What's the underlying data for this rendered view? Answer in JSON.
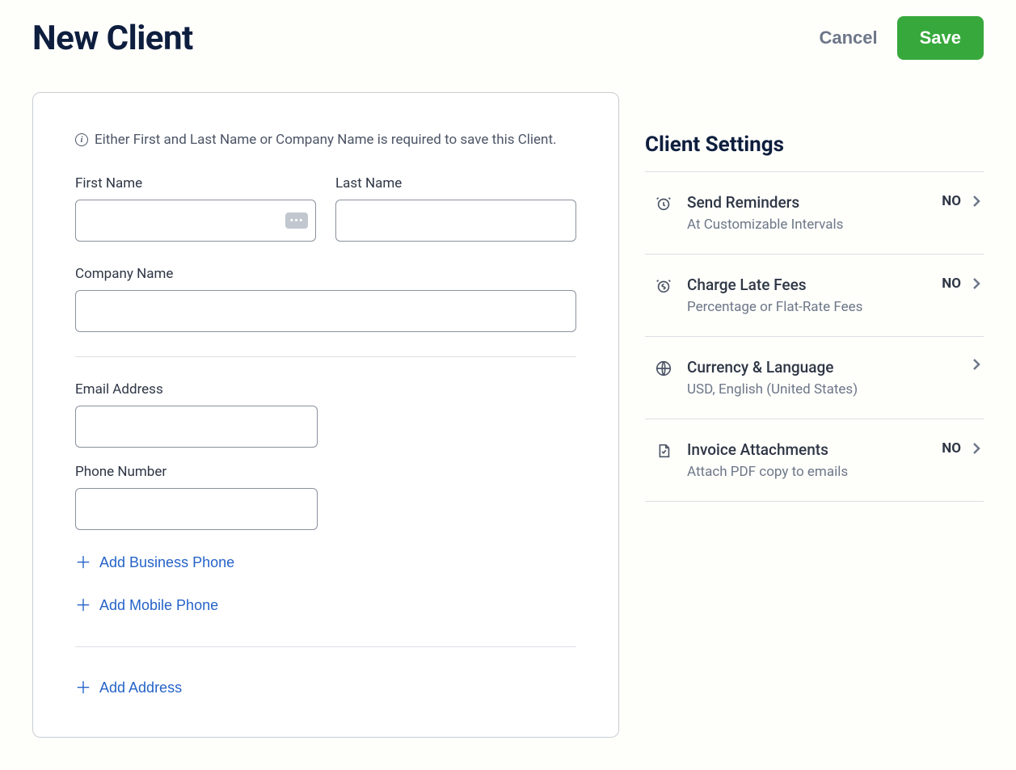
{
  "header": {
    "title": "New Client",
    "cancel_label": "Cancel",
    "save_label": "Save"
  },
  "form": {
    "info_text": "Either First and Last Name or Company Name is required to save this Client.",
    "first_name_label": "First Name",
    "first_name_value": "",
    "last_name_label": "Last Name",
    "last_name_value": "",
    "company_label": "Company Name",
    "company_value": "",
    "email_label": "Email Address",
    "email_value": "",
    "phone_label": "Phone Number",
    "phone_value": "",
    "add_business_phone": "Add Business Phone",
    "add_mobile_phone": "Add Mobile Phone",
    "add_address": "Add Address"
  },
  "sidebar": {
    "title": "Client Settings",
    "settings": {
      "reminders": {
        "title": "Send Reminders",
        "sub": "At Customizable Intervals",
        "value": "NO"
      },
      "late_fees": {
        "title": "Charge Late Fees",
        "sub": "Percentage or Flat-Rate Fees",
        "value": "NO"
      },
      "currency": {
        "title": "Currency & Language",
        "sub": "USD, English (United States)",
        "value": ""
      },
      "attachments": {
        "title": "Invoice Attachments",
        "sub": "Attach PDF copy to emails",
        "value": "NO"
      }
    }
  }
}
